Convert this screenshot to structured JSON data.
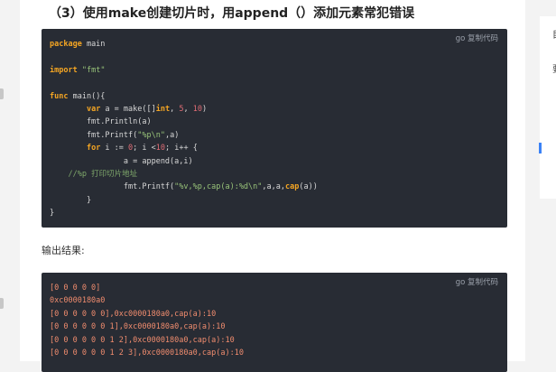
{
  "heading": "（3）使用make创建切片时，用append（）添加元素常犯错误",
  "copy_label": "go 复制代码",
  "output_label": "输出结果:",
  "right_panel": {
    "char1": "目",
    "char2": "要"
  },
  "code": [
    [
      {
        "t": "package",
        "c": "kw"
      },
      {
        "t": " main"
      }
    ],
    [],
    [
      {
        "t": "import",
        "c": "kw"
      },
      {
        "t": " "
      },
      {
        "t": "\"fmt\"",
        "c": "str"
      }
    ],
    [],
    [
      {
        "t": "func",
        "c": "kw"
      },
      {
        "t": " main(){"
      }
    ],
    [
      {
        "t": "        "
      },
      {
        "t": "var",
        "c": "kw"
      },
      {
        "t": " a = make([]"
      },
      {
        "t": "int",
        "c": "kw"
      },
      {
        "t": ", "
      },
      {
        "t": "5",
        "c": "num"
      },
      {
        "t": ", "
      },
      {
        "t": "10",
        "c": "num"
      },
      {
        "t": ")"
      }
    ],
    [
      {
        "t": "        fmt.Println(a)"
      }
    ],
    [
      {
        "t": "        fmt.Printf("
      },
      {
        "t": "\"%p\\n\"",
        "c": "str"
      },
      {
        "t": ",a)"
      }
    ],
    [
      {
        "t": "        "
      },
      {
        "t": "for",
        "c": "kw"
      },
      {
        "t": " i := "
      },
      {
        "t": "0",
        "c": "num"
      },
      {
        "t": "; i <"
      },
      {
        "t": "10",
        "c": "num"
      },
      {
        "t": "; i++ {"
      }
    ],
    [
      {
        "t": "                a = append(a,i)"
      }
    ],
    [
      {
        "t": "    "
      },
      {
        "t": "//%p 打印切片地址",
        "c": "cmt"
      }
    ],
    [
      {
        "t": "                fmt.Printf("
      },
      {
        "t": "\"%v,%p,cap(a):%d\\n\"",
        "c": "str"
      },
      {
        "t": ",a,a,"
      },
      {
        "t": "cap",
        "c": "kw"
      },
      {
        "t": "(a))"
      }
    ],
    [
      {
        "t": "        }"
      }
    ],
    [
      {
        "t": "}"
      }
    ]
  ],
  "output": [
    "[0 0 0 0 0]",
    "0xc0000180a0",
    "[0 0 0 0 0 0],0xc0000180a0,cap(a):10",
    "[0 0 0 0 0 0 1],0xc0000180a0,cap(a):10",
    "[0 0 0 0 0 0 1 2],0xc0000180a0,cap(a):10",
    "[0 0 0 0 0 0 1 2 3],0xc0000180a0,cap(a):10"
  ]
}
